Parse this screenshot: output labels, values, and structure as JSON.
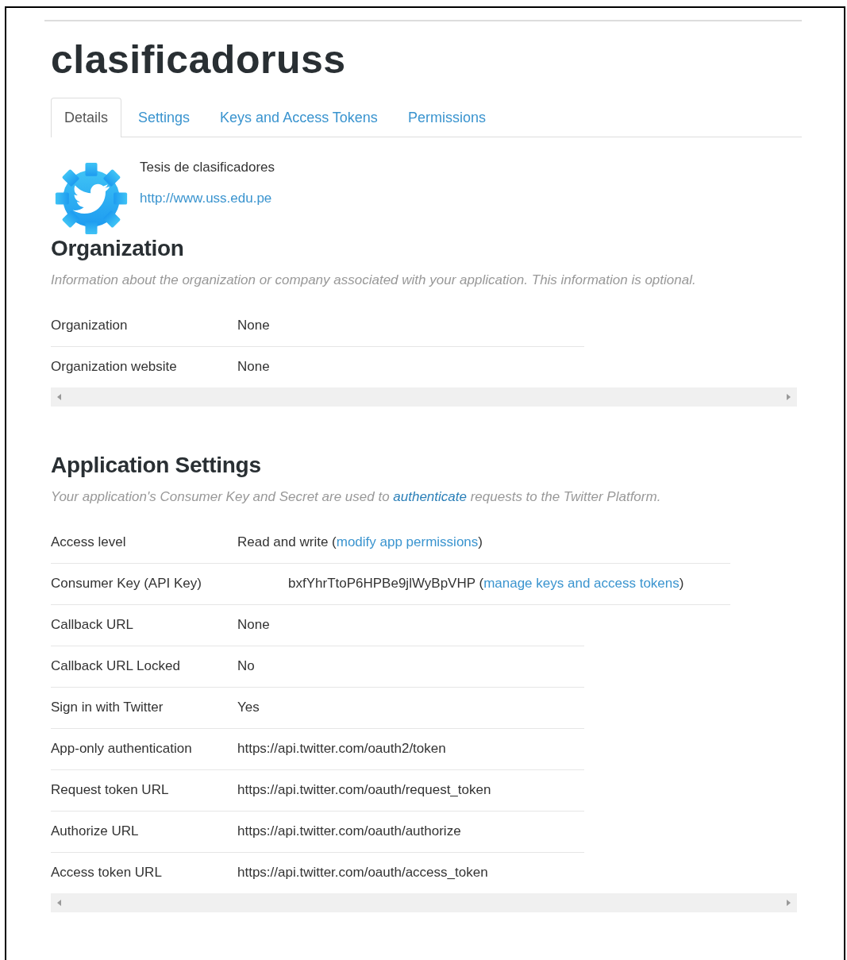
{
  "app_title": "clasificadoruss",
  "tabs": [
    {
      "label": "Details",
      "selected": true
    },
    {
      "label": "Settings",
      "selected": false
    },
    {
      "label": "Keys and Access Tokens",
      "selected": false
    },
    {
      "label": "Permissions",
      "selected": false
    }
  ],
  "app": {
    "description": "Tesis de clasificadores",
    "website": "http://www.uss.edu.pe"
  },
  "sections": [
    {
      "title": "Organization",
      "description": [
        {
          "kind": "text",
          "text": "Information about the organization or company associated with your application. This information is optional."
        }
      ],
      "rows": [
        {
          "kind": "plain",
          "label": "Organization",
          "value": [
            {
              "kind": "text",
              "text": "None"
            }
          ]
        },
        {
          "kind": "plain",
          "label": "Organization website",
          "value": [
            {
              "kind": "text",
              "text": "None"
            }
          ]
        }
      ]
    },
    {
      "title": "Application Settings",
      "description": [
        {
          "kind": "text",
          "text": "Your application's Consumer Key and Secret are used to "
        },
        {
          "kind": "link",
          "text": "authenticate"
        },
        {
          "kind": "text",
          "text": " requests to the Twitter Platform."
        }
      ],
      "rows": [
        {
          "kind": "wide",
          "label": "Access level",
          "value": [
            {
              "kind": "text",
              "text": "Read and write ("
            },
            {
              "kind": "link",
              "text": "modify app permissions"
            },
            {
              "kind": "text",
              "text": ")"
            }
          ]
        },
        {
          "kind": "indented",
          "label": "Consumer Key (API Key)",
          "value": [
            {
              "kind": "text",
              "text": "bxfYhrTtoP6HPBe9jlWyBpVHP ("
            },
            {
              "kind": "link",
              "text": "manage keys and access tokens"
            },
            {
              "kind": "text",
              "text": ")"
            }
          ]
        },
        {
          "kind": "plain",
          "label": "Callback URL",
          "value": [
            {
              "kind": "text",
              "text": "None"
            }
          ]
        },
        {
          "kind": "plain",
          "label": "Callback URL Locked",
          "value": [
            {
              "kind": "text",
              "text": "No"
            }
          ]
        },
        {
          "kind": "plain",
          "label": "Sign in with Twitter",
          "value": [
            {
              "kind": "text",
              "text": "Yes"
            }
          ]
        },
        {
          "kind": "plain",
          "label": "App-only authentication",
          "value": [
            {
              "kind": "text",
              "text": "https://api.twitter.com/oauth2/token"
            }
          ]
        },
        {
          "kind": "plain",
          "label": "Request token URL",
          "value": [
            {
              "kind": "text",
              "text": "https://api.twitter.com/oauth/request_token"
            }
          ]
        },
        {
          "kind": "plain",
          "label": "Authorize URL",
          "value": [
            {
              "kind": "text",
              "text": "https://api.twitter.com/oauth/authorize"
            }
          ]
        },
        {
          "kind": "plain",
          "label": "Access token URL",
          "value": [
            {
              "kind": "text",
              "text": "https://api.twitter.com/oauth/access_token"
            }
          ]
        }
      ]
    }
  ]
}
